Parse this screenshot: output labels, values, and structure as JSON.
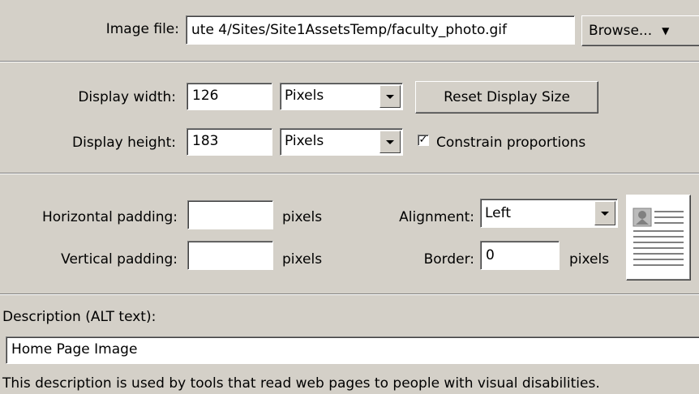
{
  "image_file": {
    "label": "Image file:",
    "value": "ute 4/Sites/Site1AssetsTemp/faculty_photo.gif",
    "browse_label": "Browse...",
    "browse_arrow": "▼"
  },
  "display": {
    "width_label": "Display width:",
    "width_value": "126",
    "width_unit": "Pixels",
    "height_label": "Display height:",
    "height_value": "183",
    "height_unit": "Pixels",
    "reset_label": "Reset Display Size",
    "constrain_label": "Constrain proportions",
    "constrain_mark": "✓"
  },
  "padding": {
    "horizontal_label": "Horizontal padding:",
    "horizontal_value": "",
    "horizontal_unit": "pixels",
    "vertical_label": "Vertical padding:",
    "vertical_value": "",
    "vertical_unit": "pixels"
  },
  "alignment": {
    "label": "Alignment:",
    "value": "Left",
    "border_label": "Border:",
    "border_value": "0",
    "border_unit": "pixels"
  },
  "description": {
    "label": "Description (ALT text):",
    "value": "Home Page Image",
    "help_text": "This description is used by tools that read web pages to people with visual disabilities."
  },
  "icons": {
    "dropdown": "chevron-down-icon",
    "alignment_preview": "image-left-aligned-preview-icon",
    "checkbox": "checkbox-checked-icon"
  }
}
